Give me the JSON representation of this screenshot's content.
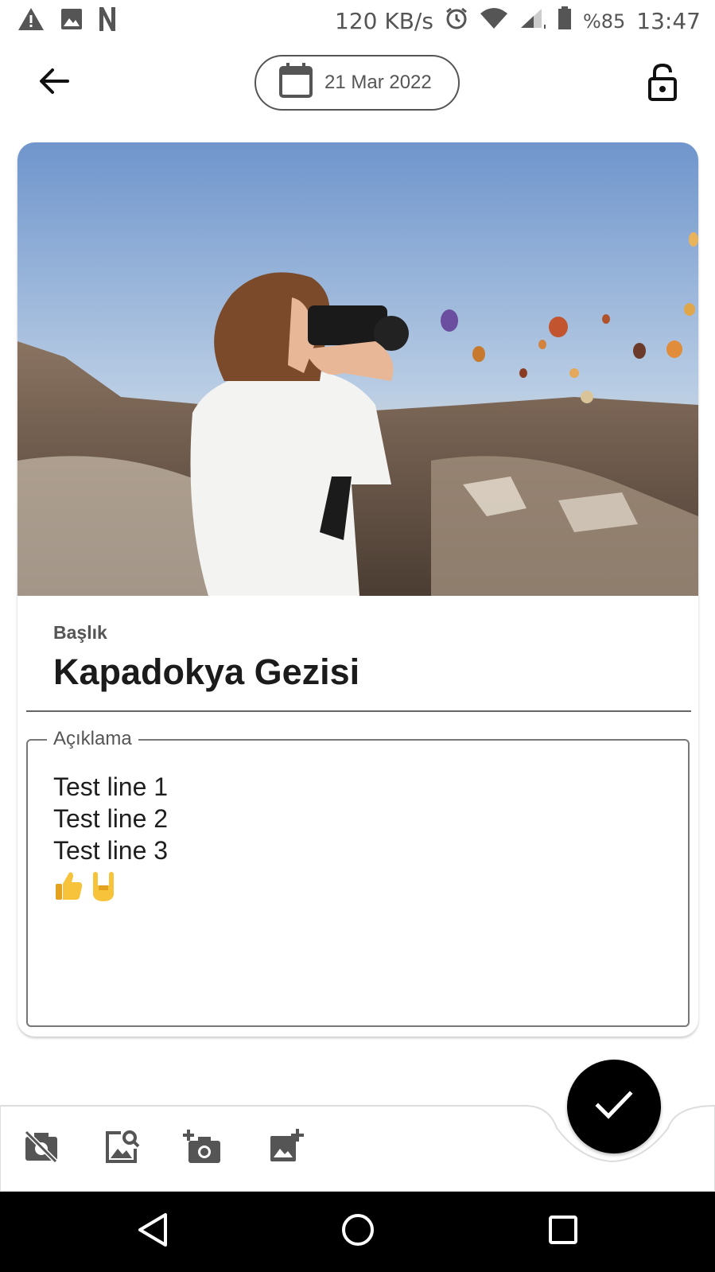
{
  "status_bar": {
    "net_speed": "120 KB/s",
    "battery": "%85",
    "time": "13:47",
    "icons": [
      "warning-icon",
      "image-icon",
      "netflix-icon",
      "alarm-icon",
      "wifi-icon",
      "signal-icon",
      "battery-icon"
    ]
  },
  "header": {
    "date": "21 Mar 2022",
    "icons": [
      "back-arrow-icon",
      "calendar-icon",
      "lock-open-icon"
    ]
  },
  "entry": {
    "title_label": "Başlık",
    "title_value": "Kapadokya Gezisi",
    "description_label": "Açıklama",
    "description_lines": [
      "Test line 1",
      "Test line 2",
      "Test line 3"
    ],
    "emojis": [
      "thumbs-up-icon",
      "rock-on-icon"
    ]
  },
  "toolbar": {
    "icons": [
      "no-photo-icon",
      "image-search-icon",
      "add-camera-icon",
      "add-image-icon"
    ],
    "fab_icon": "check-icon"
  },
  "nav": {
    "icons": [
      "nav-back-icon",
      "nav-home-icon",
      "nav-recents-icon"
    ]
  },
  "colors": {
    "accent": "#000000",
    "text": "#1b1b1b",
    "muted": "#555555"
  }
}
